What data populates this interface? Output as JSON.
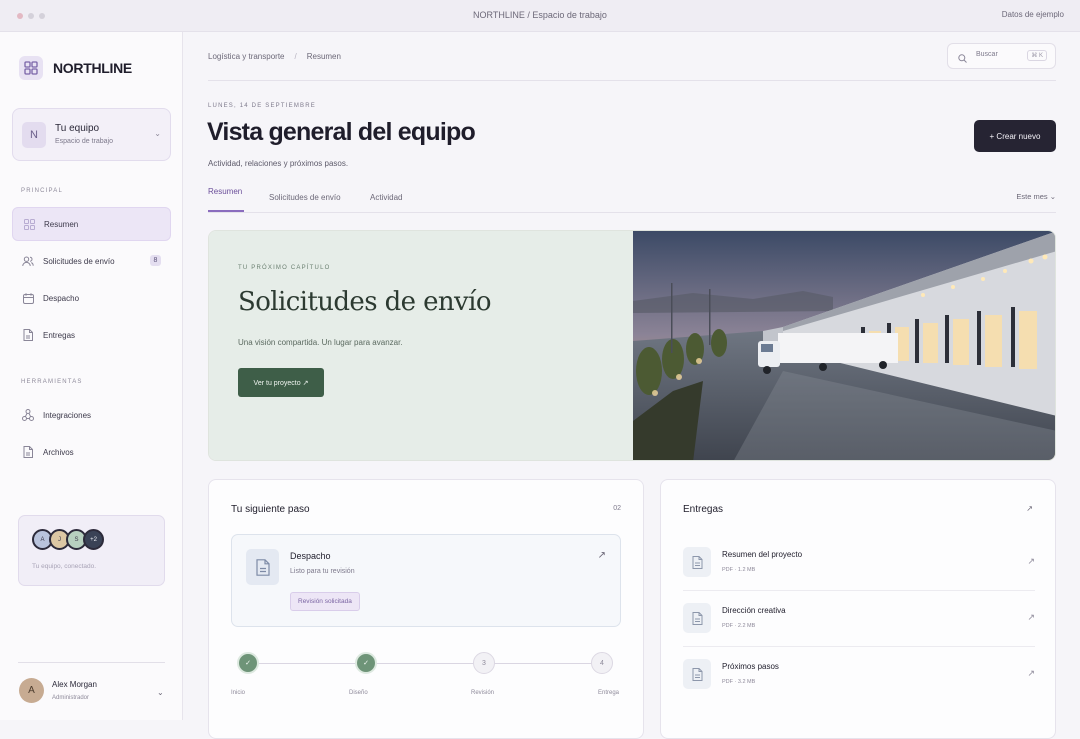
{
  "window": {
    "title": "NORTHLINE / Espacio de trabajo",
    "sample_label": "Datos de ejemplo"
  },
  "sidebar": {
    "brand": "NORTHLINE",
    "team": {
      "initial": "N",
      "name": "Tu equipo",
      "subtitle": "Espacio de trabajo"
    },
    "sections": {
      "main_label": "PRINCIPAL",
      "main_items": [
        {
          "label": "Resumen",
          "icon": "grid-icon",
          "active": true
        },
        {
          "label": "Solicitudes de envío",
          "icon": "users-icon",
          "badge": "8"
        },
        {
          "label": "Despacho",
          "icon": "calendar-icon"
        },
        {
          "label": "Entregas",
          "icon": "document-icon"
        }
      ],
      "tools_label": "HERRAMIENTAS",
      "tool_items": [
        {
          "label": "Integraciones",
          "icon": "integrations-icon"
        },
        {
          "label": "Archivos",
          "icon": "document-icon"
        }
      ]
    },
    "invite": {
      "avatars": [
        {
          "initial": "A",
          "color": "#b9c3dc"
        },
        {
          "initial": "J",
          "color": "#dcc7a4"
        },
        {
          "initial": "S",
          "color": "#b7d0bf"
        },
        {
          "initial": "+2",
          "color": "#3a4256"
        }
      ],
      "text": "Tu equipo, conectado."
    },
    "user": {
      "initial": "A",
      "name": "Alex Morgan",
      "role": "Administrador"
    }
  },
  "header": {
    "breadcrumbs": [
      "Logística y transporte",
      "Resumen"
    ],
    "search_placeholder": "Buscar",
    "search_shortcut": "⌘ K"
  },
  "page": {
    "date": "LUNES, 14 DE SEPTIEMBRE",
    "title": "Vista general del equipo",
    "subtitle": "Actividad, relaciones y próximos pasos.",
    "create_label": "+ Crear nuevo",
    "tabs": [
      "Resumen",
      "Solicitudes de envío",
      "Actividad"
    ],
    "period": "Este mes ⌄"
  },
  "hero": {
    "kicker": "TU PRÓXIMO CAPÍTULO",
    "title": "Solicitudes de envío",
    "subtitle": "Una visión compartida. Un lugar para avanzar.",
    "button_label": "Ver tu proyecto ↗"
  },
  "next_step": {
    "title": "Tu siguiente paso",
    "count": "02",
    "item": {
      "name": "Despacho",
      "subtitle": "Listo para tu revisión",
      "pill": "Revisión solicitada"
    },
    "steps": [
      {
        "label": "Inicio",
        "mark": "✓",
        "done": true
      },
      {
        "label": "Diseño",
        "mark": "✓",
        "done": true
      },
      {
        "label": "Revisión",
        "mark": "3",
        "done": false
      },
      {
        "label": "Entrega",
        "mark": "4",
        "done": false
      }
    ]
  },
  "deliveries": {
    "title": "Entregas",
    "items": [
      {
        "name": "Resumen del proyecto",
        "meta": "PDF · 1.2 MB"
      },
      {
        "name": "Dirección creativa",
        "meta": "PDF · 2.2 MB"
      },
      {
        "name": "Próximos pasos",
        "meta": "PDF · 3.2 MB"
      }
    ]
  }
}
